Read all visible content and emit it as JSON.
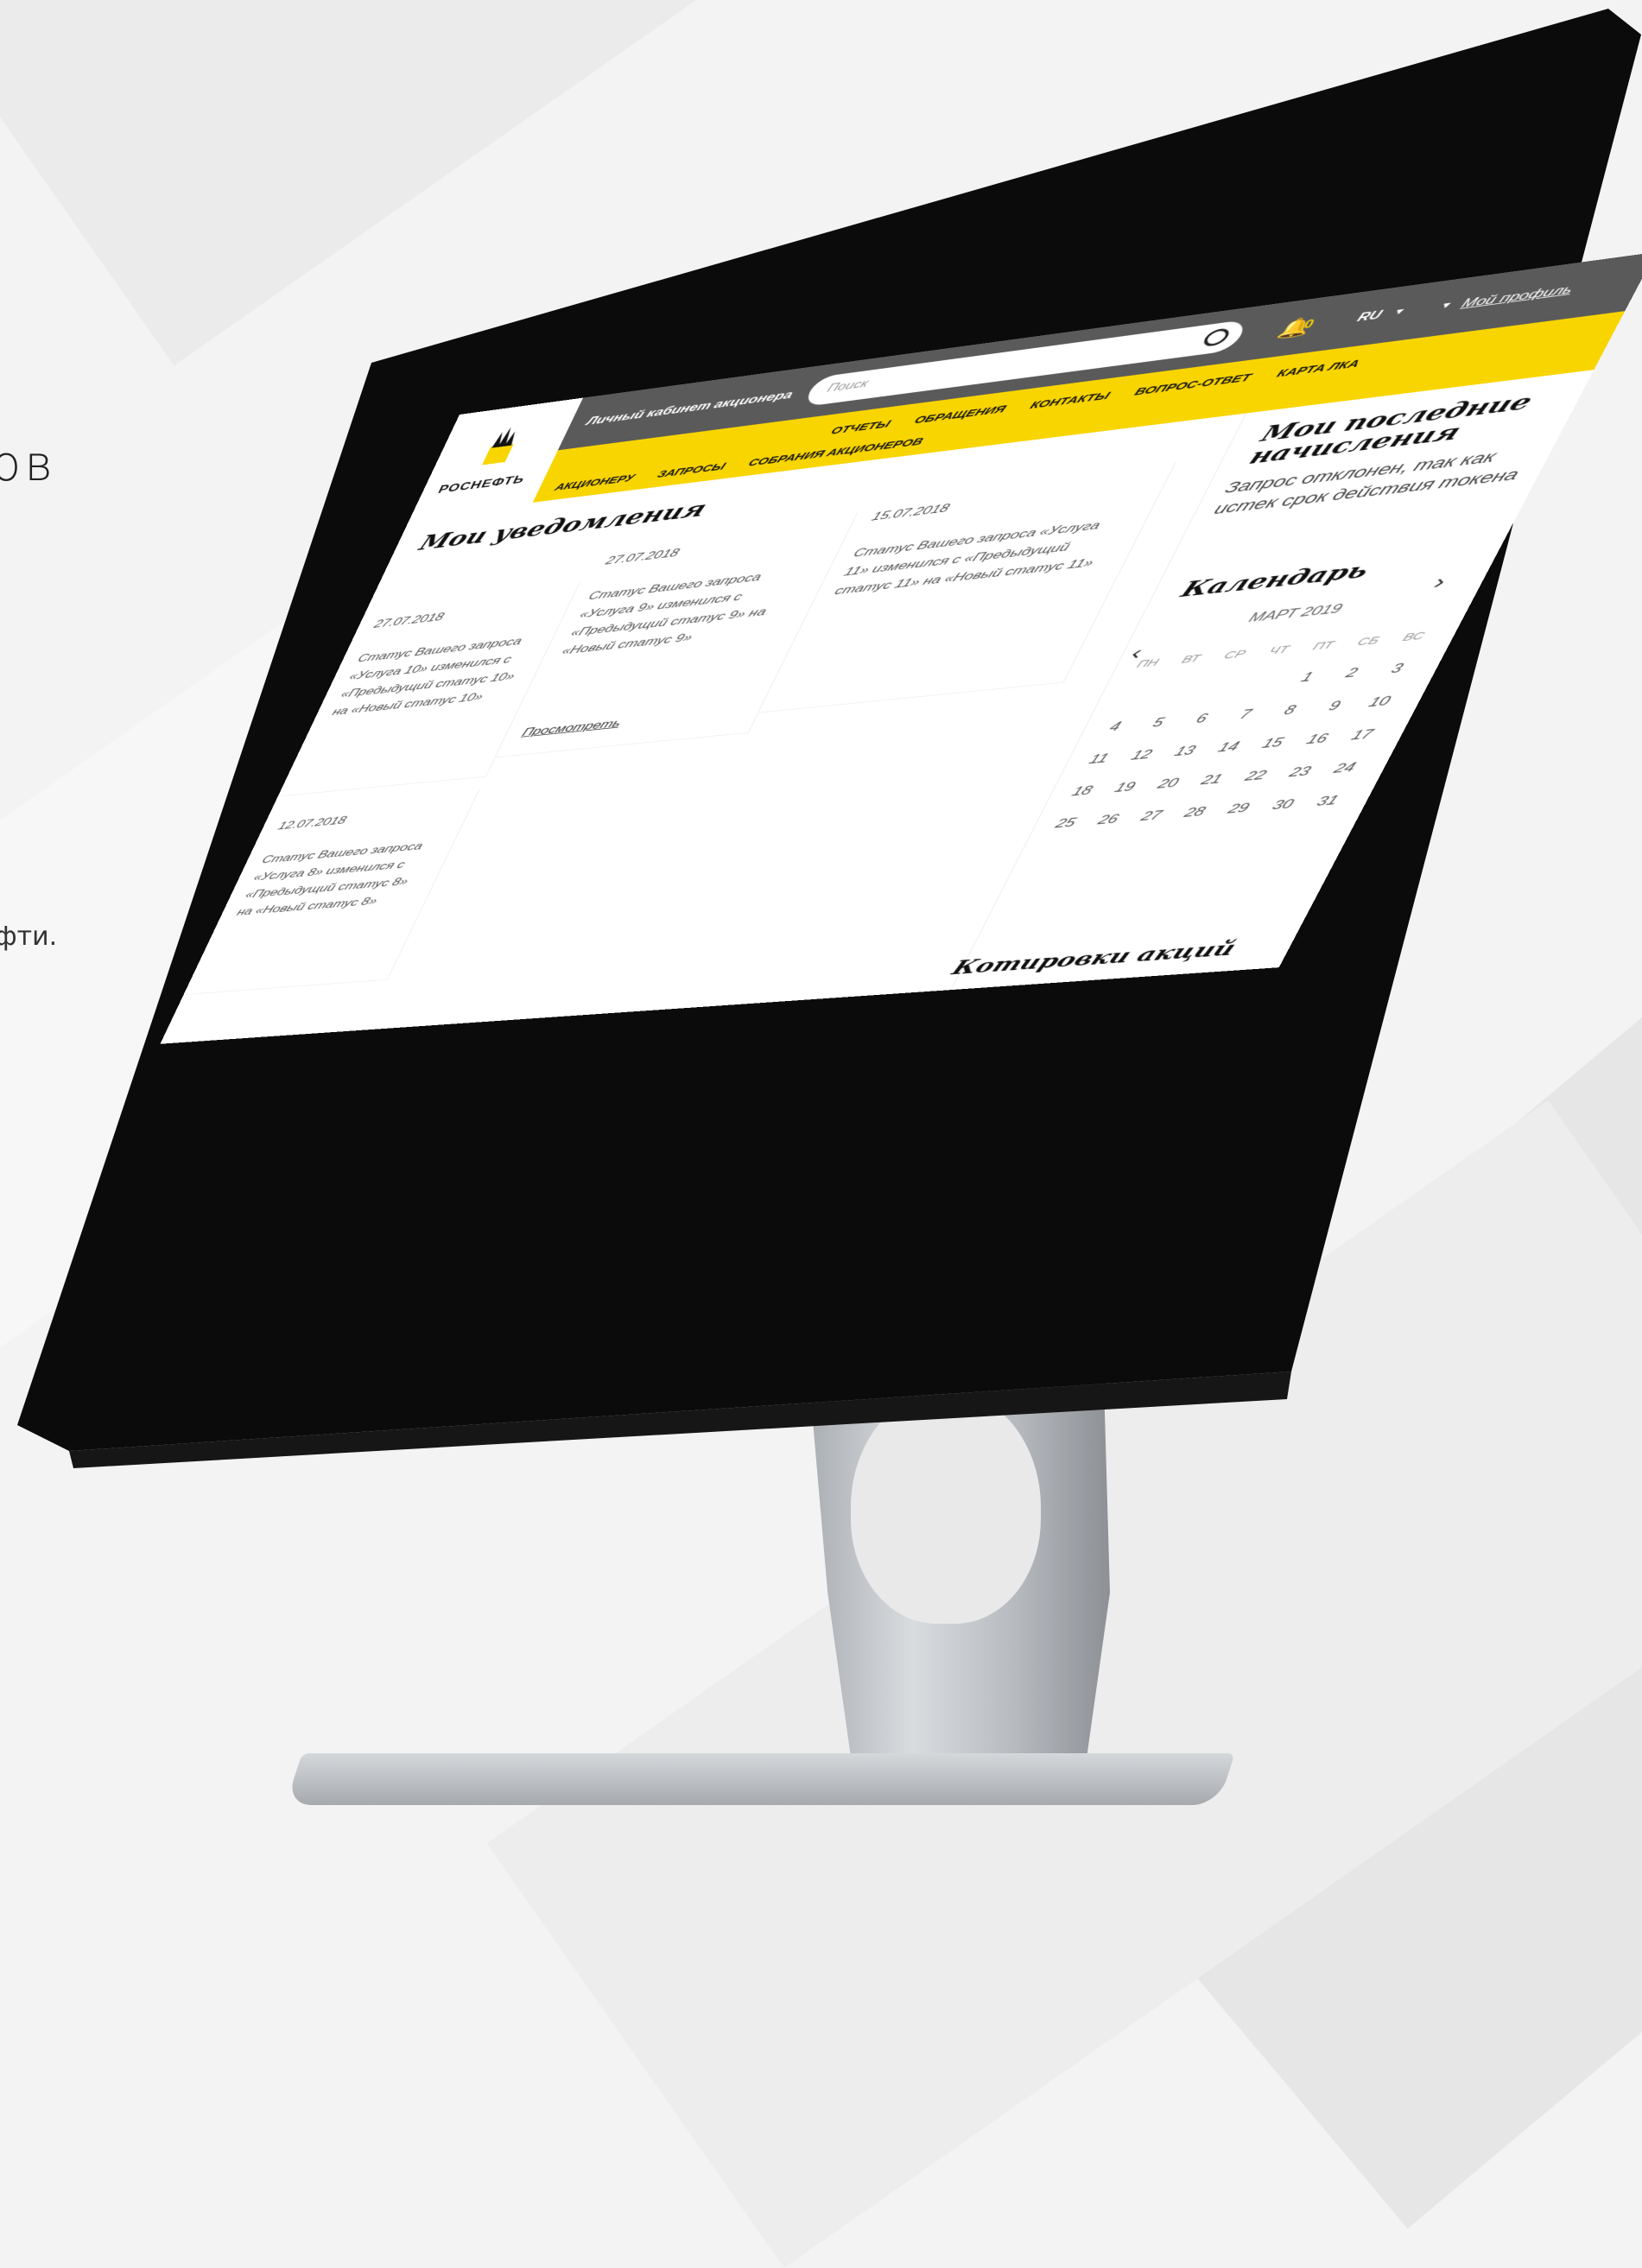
{
  "side": {
    "heading_fragment": "ов",
    "text_fragment": "фти."
  },
  "header": {
    "logo_text": "РОСНЕФТЬ",
    "cabinet_title": "Личный кабинет акционера",
    "search_placeholder": "Поиск",
    "notifications_count": "0",
    "language": "RU",
    "profile_label": "Мой профиль"
  },
  "nav": {
    "row1": [
      "ОТЧЕТЫ",
      "ОБРАЩЕНИЯ",
      "КОНТАКТЫ",
      "ВОПРОС-ОТВЕТ",
      "КАРТА ЛКА"
    ],
    "row2": [
      "АКЦИОНЕРУ",
      "ЗАПРОСЫ",
      "СОБРАНИЯ АКЦИОНЕРОВ"
    ]
  },
  "notifications": {
    "title": "Мои уведомления",
    "view_label": "Просмотреть",
    "cards": [
      {
        "date": "27.07.2018",
        "text": "Статус Вашего запроса «Услуга 10» изменился с «Предыдущий статус 10» на «Новый статус 10»"
      },
      {
        "date": "27.07.2018",
        "text": "Статус Вашего запроса «Услуга 9» изменился с «Предыдущий статус 9» на «Новый статус 9»"
      },
      {
        "date": "15.07.2018",
        "text": "Статус Вашего запроса «Услуга 11» изменился с «Предыдущий статус 11» на «Новый статус 11»"
      },
      {
        "date": "12.07.2018",
        "text": "Статус Вашего запроса «Услуга 8» изменился с «Предыдущий статус 8» на «Новый статус 8»"
      }
    ]
  },
  "accruals": {
    "title": "Мои последние начисления",
    "message": "Запрос отклонен, так как истек срок действия токена"
  },
  "calendar": {
    "title": "Календарь",
    "month": "МАРТ 2019",
    "weekdays": [
      "ПН",
      "ВТ",
      "СР",
      "ЧТ",
      "ПТ",
      "СБ",
      "ВС"
    ],
    "leading_blanks": 4,
    "days": [
      "1",
      "2",
      "3",
      "4",
      "5",
      "6",
      "7",
      "8",
      "9",
      "10",
      "11",
      "12",
      "13",
      "14",
      "15",
      "16",
      "17",
      "18",
      "19",
      "20",
      "21",
      "22",
      "23",
      "24",
      "25",
      "26",
      "27",
      "28",
      "29",
      "30",
      "31"
    ]
  },
  "quotes": {
    "title": "Котировки акций"
  },
  "colors": {
    "brand_yellow": "#f9d500",
    "topbar_gray": "#5a5a5a",
    "bezel": "#0b0b0b"
  }
}
